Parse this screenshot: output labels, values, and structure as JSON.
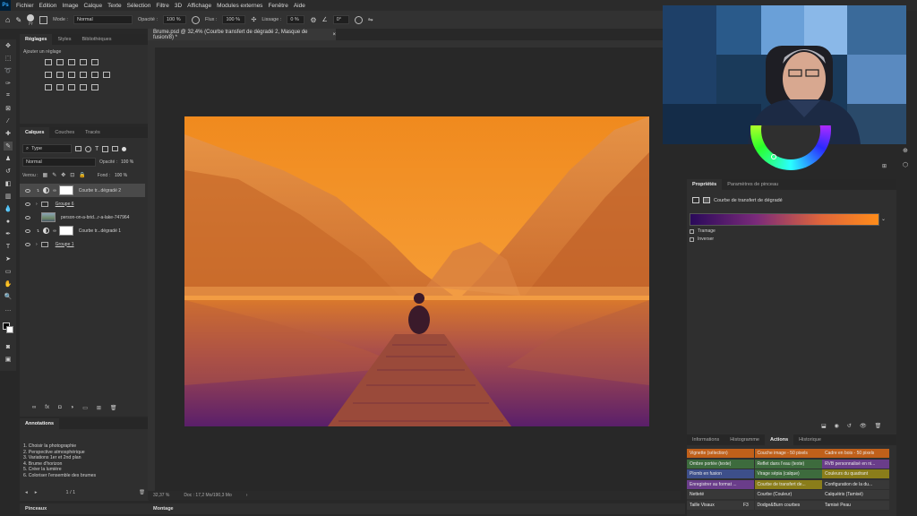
{
  "app": {
    "logo": "Ps"
  },
  "menu": [
    "Fichier",
    "Edition",
    "Image",
    "Calque",
    "Texte",
    "Sélection",
    "Filtre",
    "3D",
    "Affichage",
    "Modules externes",
    "Fenêtre",
    "Aide"
  ],
  "options": {
    "brush_size": "77",
    "mode_label": "Mode :",
    "mode_value": "Normal",
    "opacity_label": "Opacité :",
    "opacity_value": "100 %",
    "flow_label": "Flux :",
    "flow_value": "100 %",
    "smoothing_label": "Lissage :",
    "smoothing_value": "0 %",
    "angle_value": "0°"
  },
  "adjustments_panel": {
    "tabs": [
      "Réglages",
      "Styles",
      "Bibliothèques"
    ],
    "hint": "Ajouter un réglage"
  },
  "layers_panel": {
    "tabs": [
      "Calques",
      "Couches",
      "Tracés"
    ],
    "filter_value": "Type",
    "blend_value": "Normal",
    "opacity_label": "Opacité :",
    "opacity_value": "100 %",
    "lock_label": "Verrou :",
    "fill_label": "Fond :",
    "fill_value": "100 %",
    "layers": [
      {
        "name": "Courbe tr...dégradé 2",
        "kind": "adjustment"
      },
      {
        "name": "Groupe 6",
        "kind": "group"
      },
      {
        "name": "person-on-a-brid...r-a-lake-747964",
        "kind": "image"
      },
      {
        "name": "Courbe tr...dégradé 1",
        "kind": "adjustment"
      },
      {
        "name": "Groupe 1",
        "kind": "group"
      }
    ]
  },
  "document": {
    "tab_title": "Brume.psd @ 32,4% (Courbe transfert de dégradé 2, Masque de fusion/8) *",
    "zoom": "32,37 %",
    "doc_info": "Doc : 17,2 Mo/190,3 Mo"
  },
  "annotations": {
    "title": "Annotations",
    "lines": [
      "1. Choisir la photographie",
      "2. Perspective atmosphérique",
      "3. Variations 1er et 2nd plan",
      "4. Brume d'horizon",
      "5. Créer la lumière",
      "6. Coloriser l'ensemble des brumes"
    ],
    "pager": "1 / 1"
  },
  "bottom_tabs": {
    "left": "Pinceaux",
    "center": "Montage"
  },
  "properties": {
    "tabs": [
      "Propriétés",
      "Paramètres de pinceau"
    ],
    "subtitle": "Courbe de transfert de dégradé",
    "dither_label": "Tramage",
    "reverse_label": "Inverser"
  },
  "actions_panel": {
    "tabs": [
      "Informations",
      "Histogramme",
      "Actions",
      "Historique"
    ],
    "items": [
      {
        "label": "Vignette (sélection)",
        "color": "#c0601a"
      },
      {
        "label": "Couche image - 50 pixels",
        "color": "#c0601a"
      },
      {
        "label": "Cadre en bois - 50 pixels",
        "color": "#c0601a"
      },
      {
        "label": "Ombre portée (texte)",
        "color": "#3d6b3d"
      },
      {
        "label": "Reflet dans l'eau (texte)",
        "color": "#3d6b3d"
      },
      {
        "label": "RVB personnalisé en ni...",
        "color": "#6a3d8a"
      },
      {
        "label": "Plomb en fusion",
        "color": "#3d4f8a"
      },
      {
        "label": "Virage sépia (calque)",
        "color": "#3d6b3d"
      },
      {
        "label": "Couleurs du quadrant",
        "color": "#8a7d1a"
      },
      {
        "label": "Enregistrer au format ...",
        "color": "#6a3d8a"
      },
      {
        "label": "Courbe de transfert de...",
        "color": "#8a7d1a"
      },
      {
        "label": "Configuration de la du...",
        "color": "#383838"
      },
      {
        "label": "Netteté",
        "color": "#383838"
      },
      {
        "label": "Courbe (Couleur)",
        "color": "#383838"
      },
      {
        "label": "Calquéiris (Tamisé)",
        "color": "#383838"
      },
      {
        "label": "Taille Visaux",
        "color": "#383838"
      },
      {
        "label": "Dodge&Burn courbes",
        "color": "#383838"
      },
      {
        "label": "Tamisé Peau",
        "color": "#383838"
      }
    ],
    "shortcut": "F3"
  }
}
